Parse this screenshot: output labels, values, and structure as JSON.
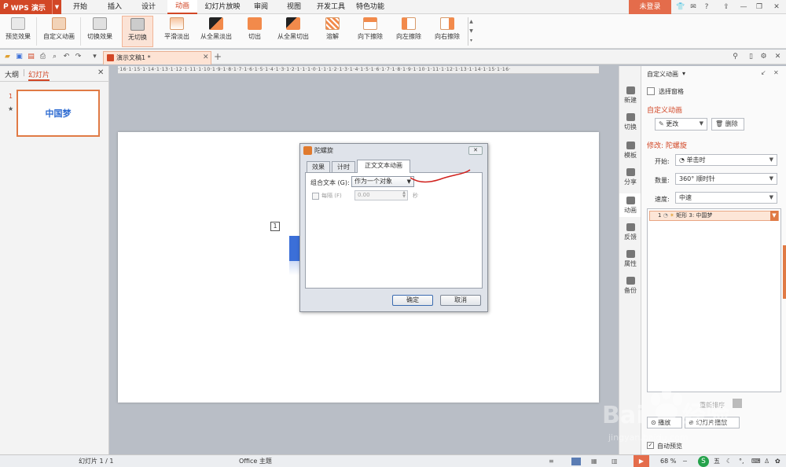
{
  "app": {
    "logo": "WPS 演示"
  },
  "menu": {
    "tabs": [
      "开始",
      "插入",
      "设计",
      "动画",
      "幻灯片放映",
      "审阅",
      "视图",
      "开发工具",
      "特色功能"
    ],
    "login": "未登录"
  },
  "ribbon": {
    "buttons": [
      "预览效果",
      "自定义动画",
      "切换效果",
      "无切换",
      "平滑淡出",
      "从全黑淡出",
      "切出",
      "从全黑切出",
      "溶解",
      "向下擦除",
      "向左擦除",
      "向右擦除"
    ]
  },
  "document": {
    "tab_title": "演示文稿1 *"
  },
  "left_panel": {
    "tab_outline": "大纲",
    "tab_slides": "幻灯片",
    "slide_number": "1",
    "thumb_text": "中国梦"
  },
  "ruler": {
    "text": "·16·1·15·1·14·1·13·1·12·1·11·1·10·1·9·1·8·1·7·1·6·1·5·1·4·1·3·1·2·1·1·1·0·1·1·1·2·1·3·1·4·1·5·1·6·1·7·1·8·1·9·1·10·1·11·1·12·1·13·1·14·1·15·1·16·"
  },
  "slide": {
    "anim_marker": "1"
  },
  "dialog": {
    "title": "陀螺旋",
    "tabs": [
      "效果",
      "计时",
      "正文文本动画"
    ],
    "group_text_label": "组合文本 (G):",
    "group_text_value": "作为一个对象",
    "every_label": "每隔 (F)",
    "every_value": "0.00",
    "every_unit": "秒",
    "ok": "确定",
    "cancel": "取消"
  },
  "right_strip": [
    "新建",
    "切换",
    "模板",
    "分享",
    "动画",
    "反馈",
    "属性",
    "备份"
  ],
  "task_pane": {
    "title": "自定义动画",
    "select_pane": "选择窗格",
    "section_title": "自定义动画",
    "change_btn": "更改",
    "delete_btn": "删除",
    "modify_title": "修改: 陀螺旋",
    "start_label": "开始:",
    "start_value": "单击时",
    "amount_label": "数量:",
    "amount_value": "360° 顺时针",
    "speed_label": "速度:",
    "speed_value": "中速",
    "list_item_num": "1",
    "list_item_text": "矩形 3: 中国梦",
    "reorder_label": "重新排序",
    "play_btn": "播放",
    "slideshow_btn": "幻灯片播放",
    "autopreview": "自动预览"
  },
  "status": {
    "slide": "幻灯片 1 / 1",
    "theme": "Office 主题",
    "zoom": "68 %"
  },
  "colors": {
    "accent": "#d24726",
    "shape_blue": "#3b6fd8"
  }
}
